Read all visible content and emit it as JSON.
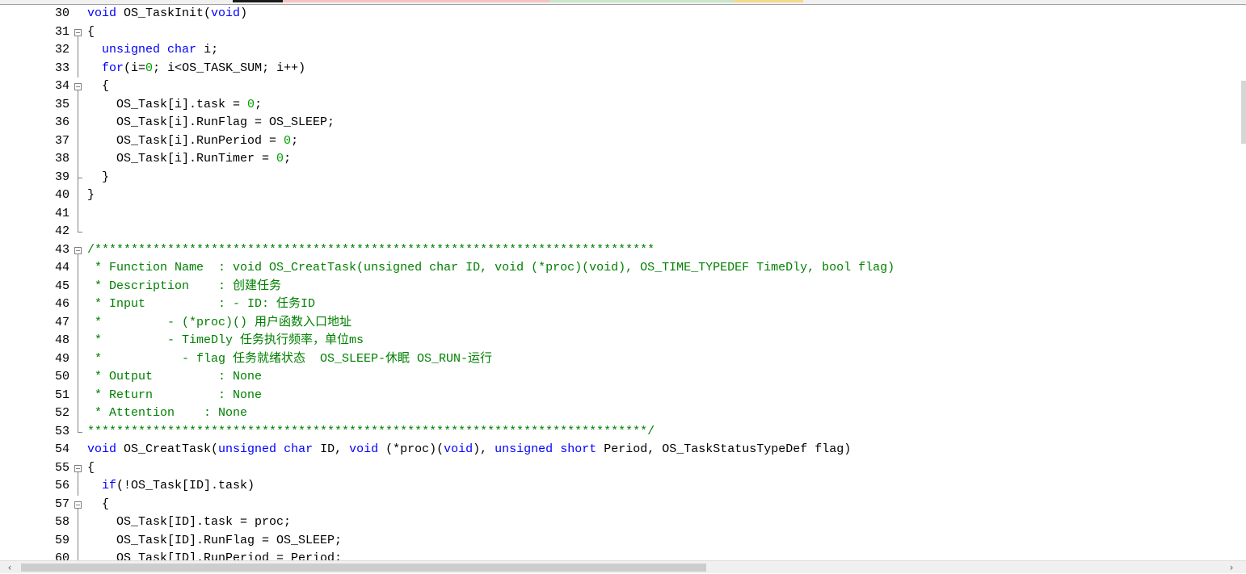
{
  "editor": {
    "colors": {
      "keyword": "#0000ff",
      "number": "#00a000",
      "comment": "#008000",
      "text": "#000000",
      "gutter_text": "#000000",
      "fold_marker": "#808080"
    },
    "lines": [
      {
        "num": "30",
        "fold": "",
        "segments": [
          {
            "t": "void",
            "c": "kw"
          },
          {
            "t": " OS_TaskInit(",
            "c": "tx"
          },
          {
            "t": "void",
            "c": "kw"
          },
          {
            "t": ")",
            "c": "tx"
          }
        ]
      },
      {
        "num": "31",
        "fold": "open",
        "segments": [
          {
            "t": "{",
            "c": "tx"
          }
        ]
      },
      {
        "num": "32",
        "fold": "line",
        "segments": [
          {
            "t": "  ",
            "c": "tx"
          },
          {
            "t": "unsigned",
            "c": "kw"
          },
          {
            "t": " ",
            "c": "tx"
          },
          {
            "t": "char",
            "c": "kw"
          },
          {
            "t": " i;",
            "c": "tx"
          }
        ]
      },
      {
        "num": "33",
        "fold": "line",
        "segments": [
          {
            "t": "  ",
            "c": "tx"
          },
          {
            "t": "for",
            "c": "kw"
          },
          {
            "t": "(i=",
            "c": "tx"
          },
          {
            "t": "0",
            "c": "num"
          },
          {
            "t": "; i<OS_TASK_SUM; i++)",
            "c": "tx"
          }
        ]
      },
      {
        "num": "34",
        "fold": "open",
        "segments": [
          {
            "t": "  {",
            "c": "tx"
          }
        ]
      },
      {
        "num": "35",
        "fold": "line",
        "segments": [
          {
            "t": "    OS_Task[i].task = ",
            "c": "tx"
          },
          {
            "t": "0",
            "c": "num"
          },
          {
            "t": ";",
            "c": "tx"
          }
        ]
      },
      {
        "num": "36",
        "fold": "line",
        "segments": [
          {
            "t": "    OS_Task[i].RunFlag = OS_SLEEP;",
            "c": "tx"
          }
        ]
      },
      {
        "num": "37",
        "fold": "line",
        "segments": [
          {
            "t": "    OS_Task[i].RunPeriod = ",
            "c": "tx"
          },
          {
            "t": "0",
            "c": "num"
          },
          {
            "t": ";",
            "c": "tx"
          }
        ]
      },
      {
        "num": "38",
        "fold": "line",
        "segments": [
          {
            "t": "    OS_Task[i].RunTimer = ",
            "c": "tx"
          },
          {
            "t": "0",
            "c": "num"
          },
          {
            "t": ";",
            "c": "tx"
          }
        ]
      },
      {
        "num": "39",
        "fold": "tick",
        "segments": [
          {
            "t": "  }",
            "c": "tx"
          }
        ]
      },
      {
        "num": "40",
        "fold": "line",
        "segments": [
          {
            "t": "}",
            "c": "tx"
          }
        ]
      },
      {
        "num": "41",
        "fold": "line",
        "segments": []
      },
      {
        "num": "42",
        "fold": "end",
        "segments": []
      },
      {
        "num": "43",
        "fold": "open",
        "segments": [
          {
            "t": "/*****************************************************************************",
            "c": "cm"
          }
        ]
      },
      {
        "num": "44",
        "fold": "line",
        "segments": [
          {
            "t": " * Function Name  : void OS_CreatTask(unsigned char ID, void (*proc)(void), OS_TIME_TYPEDEF TimeDly, bool flag)",
            "c": "cm"
          }
        ]
      },
      {
        "num": "45",
        "fold": "line",
        "segments": [
          {
            "t": " * Description    : 创建任务",
            "c": "cm"
          }
        ]
      },
      {
        "num": "46",
        "fold": "line",
        "segments": [
          {
            "t": " * Input          : - ID: 任务ID",
            "c": "cm"
          }
        ]
      },
      {
        "num": "47",
        "fold": "line",
        "segments": [
          {
            "t": " *         - (*proc)() 用户函数入口地址",
            "c": "cm"
          }
        ]
      },
      {
        "num": "48",
        "fold": "line",
        "segments": [
          {
            "t": " *         - TimeDly 任务执行频率，单位ms",
            "c": "cm"
          }
        ]
      },
      {
        "num": "49",
        "fold": "line",
        "segments": [
          {
            "t": " *           - flag 任务就绪状态  OS_SLEEP-休眠 OS_RUN-运行",
            "c": "cm"
          }
        ]
      },
      {
        "num": "50",
        "fold": "line",
        "segments": [
          {
            "t": " * Output         : None",
            "c": "cm"
          }
        ]
      },
      {
        "num": "51",
        "fold": "line",
        "segments": [
          {
            "t": " * Return         : None",
            "c": "cm"
          }
        ]
      },
      {
        "num": "52",
        "fold": "line",
        "segments": [
          {
            "t": " * Attention    : None",
            "c": "cm"
          }
        ]
      },
      {
        "num": "53",
        "fold": "end",
        "segments": [
          {
            "t": "*****************************************************************************/",
            "c": "cm"
          }
        ]
      },
      {
        "num": "54",
        "fold": "",
        "segments": [
          {
            "t": "void",
            "c": "kw"
          },
          {
            "t": " OS_CreatTask(",
            "c": "tx"
          },
          {
            "t": "unsigned",
            "c": "kw"
          },
          {
            "t": " ",
            "c": "tx"
          },
          {
            "t": "char",
            "c": "kw"
          },
          {
            "t": " ID, ",
            "c": "tx"
          },
          {
            "t": "void",
            "c": "kw"
          },
          {
            "t": " (*proc)(",
            "c": "tx"
          },
          {
            "t": "void",
            "c": "kw"
          },
          {
            "t": "), ",
            "c": "tx"
          },
          {
            "t": "unsigned",
            "c": "kw"
          },
          {
            "t": " ",
            "c": "tx"
          },
          {
            "t": "short",
            "c": "kw"
          },
          {
            "t": " Period, OS_TaskStatusTypeDef flag)",
            "c": "tx"
          }
        ]
      },
      {
        "num": "55",
        "fold": "open",
        "segments": [
          {
            "t": "{",
            "c": "tx"
          }
        ]
      },
      {
        "num": "56",
        "fold": "line",
        "segments": [
          {
            "t": "  ",
            "c": "tx"
          },
          {
            "t": "if",
            "c": "kw"
          },
          {
            "t": "(!OS_Task[ID].task)",
            "c": "tx"
          }
        ]
      },
      {
        "num": "57",
        "fold": "open",
        "segments": [
          {
            "t": "  {",
            "c": "tx"
          }
        ]
      },
      {
        "num": "58",
        "fold": "line",
        "segments": [
          {
            "t": "    OS_Task[ID].task = proc;",
            "c": "tx"
          }
        ]
      },
      {
        "num": "59",
        "fold": "line",
        "segments": [
          {
            "t": "    OS_Task[ID].RunFlag = OS_SLEEP;",
            "c": "tx"
          }
        ]
      },
      {
        "num": "60",
        "fold": "line",
        "segments": [
          {
            "t": "    OS_Task[ID].RunPeriod = Period;",
            "c": "tx"
          }
        ]
      }
    ]
  },
  "scrollbar": {
    "left_arrow": "‹",
    "right_arrow": "›"
  }
}
